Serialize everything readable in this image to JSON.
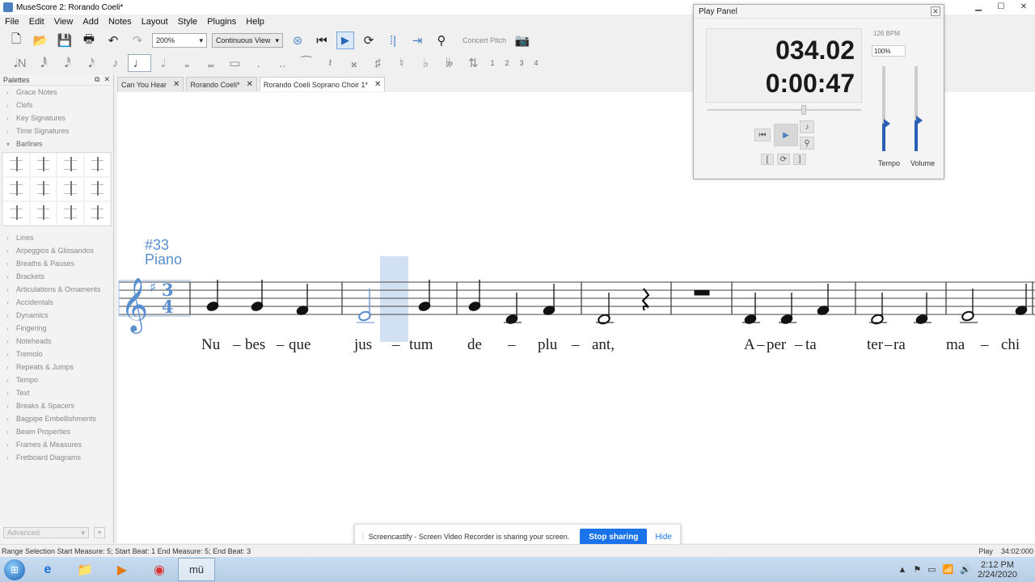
{
  "window": {
    "title": "MuseScore 2: Rorando Coeli*"
  },
  "menu": [
    "File",
    "Edit",
    "View",
    "Add",
    "Notes",
    "Layout",
    "Style",
    "Plugins",
    "Help"
  ],
  "toolbar": {
    "zoom": "200%",
    "view_mode": "Continuous View",
    "concert_pitch": "Concert Pitch"
  },
  "note_input": {
    "voices": [
      "1",
      "2",
      "3",
      "4"
    ]
  },
  "palettes": {
    "title": "Palettes",
    "items_top": [
      "Grace Notes",
      "Clefs",
      "Key Signatures",
      "Time Signatures",
      "Barlines"
    ],
    "items_bottom": [
      "Lines",
      "Arpeggios & Glissandos",
      "Breaths & Pauses",
      "Brackets",
      "Articulations & Ornaments",
      "Accidentals",
      "Dynamics",
      "Fingering",
      "Noteheads",
      "Tremolo",
      "Repeats & Jumps",
      "Tempo",
      "Text",
      "Breaks & Spacers",
      "Bagpipe Embellishments",
      "Beam Properties",
      "Frames & Measures",
      "Fretboard Diagrams"
    ],
    "workspace": "Advanced"
  },
  "tabs": [
    {
      "label": "Can You Hear"
    },
    {
      "label": "Rorando Coeli*"
    },
    {
      "label": "Rorando Coeli Soprano Choir 1*"
    }
  ],
  "score": {
    "rehearsal": "#33",
    "instrument": "Piano",
    "lyrics": [
      "Nu",
      "–",
      "bes",
      "–",
      "que",
      "jus",
      "–",
      "tum",
      "de",
      "–",
      "plu",
      "–",
      "ant,",
      "A",
      "–",
      "per",
      "–",
      "ta",
      "ter",
      "–",
      "ra",
      "ma",
      "–",
      "chi"
    ]
  },
  "play_panel": {
    "title": "Play Panel",
    "measure": "034.02",
    "time": "0:00:47",
    "bpm": "126 BPM",
    "tempo_percent": "100%",
    "tempo_label": "Tempo",
    "volume_label": "Volume",
    "tempo_level": 0.32,
    "volume_level": 0.36
  },
  "status": {
    "left": "Range Selection Start Measure: 5; Start Beat: 1 End Measure: 5; End Beat: 3",
    "right_mode": "Play",
    "right_pos": "34:02:000"
  },
  "share_bar": {
    "message": "Screencastify - Screen Video Recorder is sharing your screen.",
    "stop_label": "Stop sharing",
    "hide_label": "Hide"
  },
  "taskbar": {
    "time": "2:12 PM",
    "date": "2/24/2020"
  }
}
